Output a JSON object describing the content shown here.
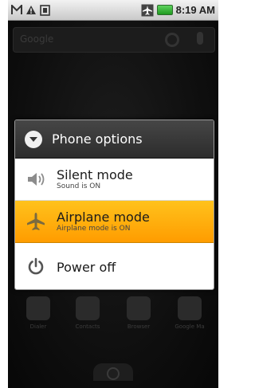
{
  "status_bar": {
    "time": "8:19 AM",
    "icons": [
      "gmail-icon",
      "warning-icon",
      "sd-card-icon",
      "airplane-signal-icon",
      "battery-icon"
    ]
  },
  "home": {
    "search_hint": "Google",
    "apps": [
      "Dialer",
      "Contacts",
      "Browser",
      "Google Ma"
    ]
  },
  "dialog": {
    "title": "Phone options",
    "options": [
      {
        "label": "Silent mode",
        "sub": "Sound is ON",
        "icon": "speaker-icon",
        "selected": false
      },
      {
        "label": "Airplane mode",
        "sub": "Airplane mode is ON",
        "icon": "airplane-icon",
        "selected": true
      },
      {
        "label": "Power off",
        "sub": "",
        "icon": "power-icon",
        "selected": false
      }
    ]
  },
  "colors": {
    "selected_bg": "#ffb000",
    "header_bg": "#3a3a3a",
    "battery": "#3cc03c"
  }
}
